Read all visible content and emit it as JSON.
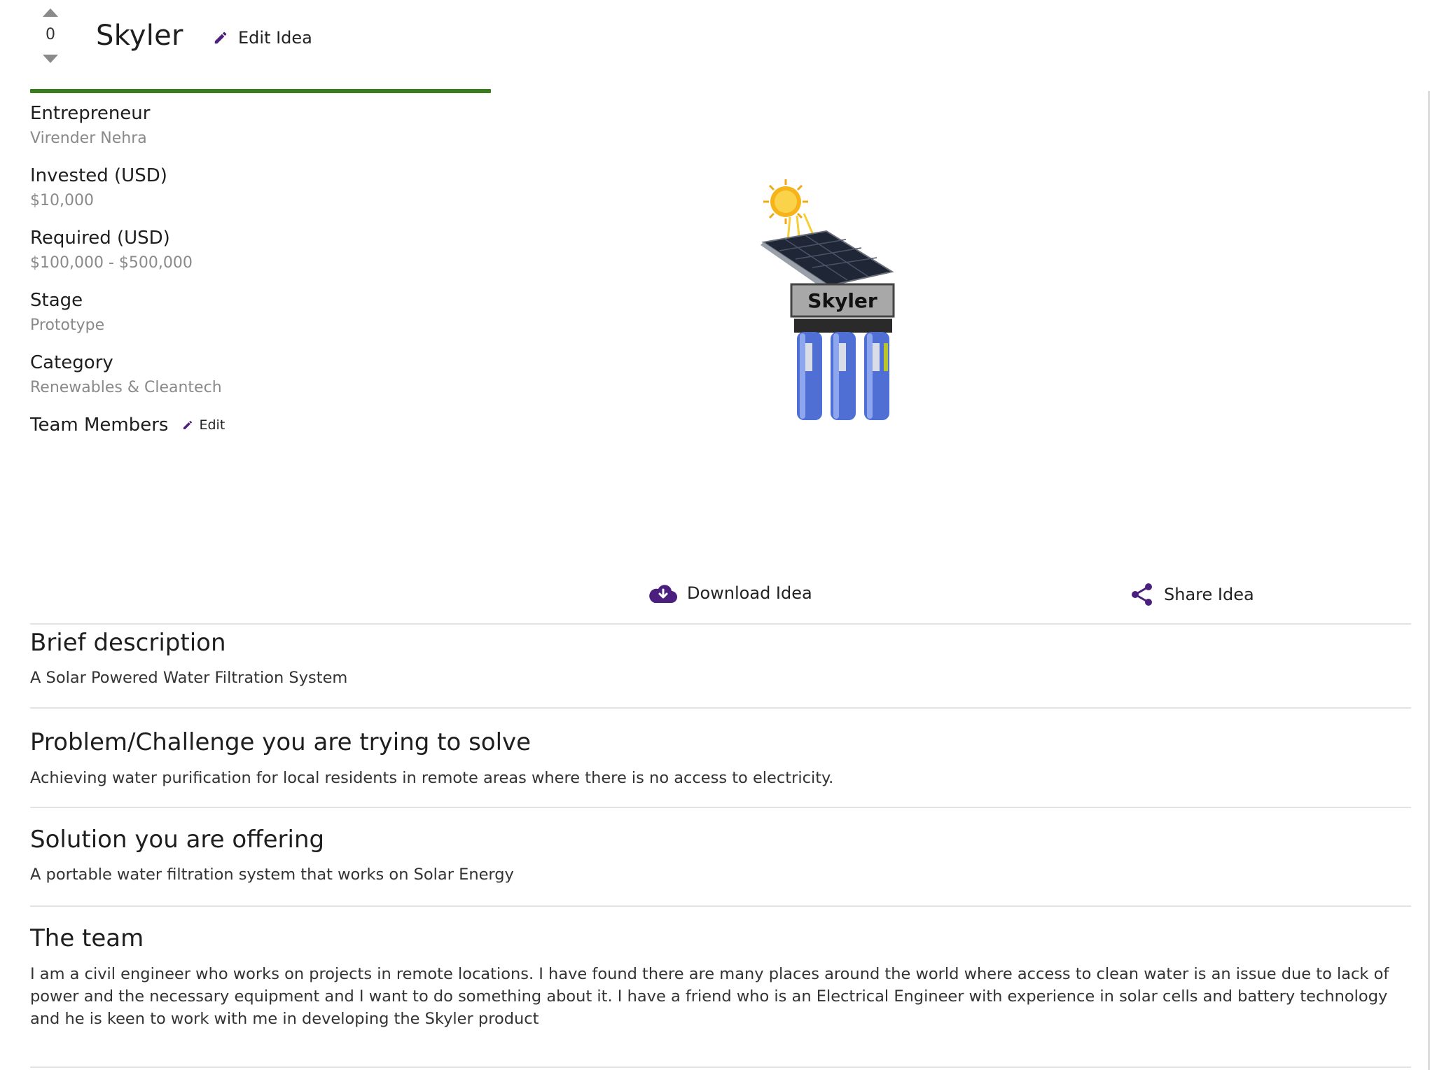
{
  "header": {
    "vote_count": "0",
    "title": "Skyler",
    "edit_idea_label": "Edit Idea"
  },
  "progress": {
    "value": 1.0,
    "color": "#3a7d1c"
  },
  "details": [
    {
      "label": "Entrepreneur",
      "value": "Virender Nehra"
    },
    {
      "label": "Invested (USD)",
      "value": "$10,000"
    },
    {
      "label": "Required (USD)",
      "value": "$100,000 - $500,000"
    },
    {
      "label": "Stage",
      "value": "Prototype"
    },
    {
      "label": "Category",
      "value": "Renewables & Cleantech"
    }
  ],
  "team_members": {
    "label": "Team Members",
    "edit_label": "Edit"
  },
  "product_image": {
    "logo_text": "Skyler"
  },
  "actions": {
    "download_label": "Download Idea",
    "share_label": "Share Idea"
  },
  "sections": [
    {
      "title": "Brief description",
      "body": "A Solar Powered Water Filtration System"
    },
    {
      "title": "Problem/Challenge you are trying to solve",
      "body": "Achieving water purification for local residents in remote areas where there is no access to electricity."
    },
    {
      "title": "Solution you are offering",
      "body": "A portable water filtration system that works on Solar Energy"
    },
    {
      "title": "The team",
      "body": "I am a civil engineer who works on projects in remote locations. I have found there are many places around the world where access to clean water is an issue due to lack of power and the necessary equipment and I want to do something about it. I have a friend who is an Electrical Engineer with experience in solar cells and battery technology and he is keen to work with me in developing the Skyler product"
    }
  ],
  "colors": {
    "accent": "#4b1f7e",
    "progress": "#3a7d1c",
    "muted": "#8a8a8a"
  },
  "icons": [
    "chevron-up-icon",
    "chevron-down-icon",
    "pencil-icon",
    "cloud-download-icon",
    "share-icon"
  ]
}
